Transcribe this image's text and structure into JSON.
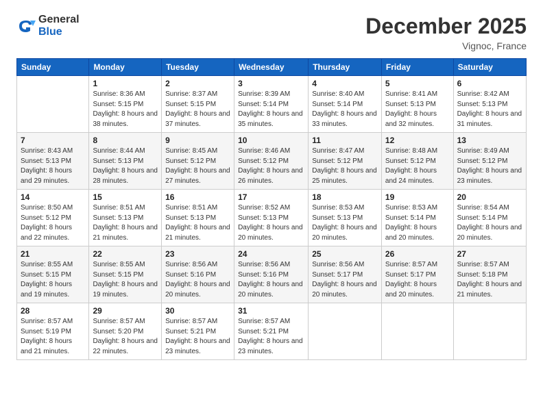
{
  "logo": {
    "general": "General",
    "blue": "Blue"
  },
  "header": {
    "month": "December 2025",
    "location": "Vignoc, France"
  },
  "weekdays": [
    "Sunday",
    "Monday",
    "Tuesday",
    "Wednesday",
    "Thursday",
    "Friday",
    "Saturday"
  ],
  "weeks": [
    [
      {
        "num": "",
        "sunrise": "",
        "sunset": "",
        "daylight": ""
      },
      {
        "num": "1",
        "sunrise": "Sunrise: 8:36 AM",
        "sunset": "Sunset: 5:15 PM",
        "daylight": "Daylight: 8 hours and 38 minutes."
      },
      {
        "num": "2",
        "sunrise": "Sunrise: 8:37 AM",
        "sunset": "Sunset: 5:15 PM",
        "daylight": "Daylight: 8 hours and 37 minutes."
      },
      {
        "num": "3",
        "sunrise": "Sunrise: 8:39 AM",
        "sunset": "Sunset: 5:14 PM",
        "daylight": "Daylight: 8 hours and 35 minutes."
      },
      {
        "num": "4",
        "sunrise": "Sunrise: 8:40 AM",
        "sunset": "Sunset: 5:14 PM",
        "daylight": "Daylight: 8 hours and 33 minutes."
      },
      {
        "num": "5",
        "sunrise": "Sunrise: 8:41 AM",
        "sunset": "Sunset: 5:13 PM",
        "daylight": "Daylight: 8 hours and 32 minutes."
      },
      {
        "num": "6",
        "sunrise": "Sunrise: 8:42 AM",
        "sunset": "Sunset: 5:13 PM",
        "daylight": "Daylight: 8 hours and 31 minutes."
      }
    ],
    [
      {
        "num": "7",
        "sunrise": "Sunrise: 8:43 AM",
        "sunset": "Sunset: 5:13 PM",
        "daylight": "Daylight: 8 hours and 29 minutes."
      },
      {
        "num": "8",
        "sunrise": "Sunrise: 8:44 AM",
        "sunset": "Sunset: 5:13 PM",
        "daylight": "Daylight: 8 hours and 28 minutes."
      },
      {
        "num": "9",
        "sunrise": "Sunrise: 8:45 AM",
        "sunset": "Sunset: 5:12 PM",
        "daylight": "Daylight: 8 hours and 27 minutes."
      },
      {
        "num": "10",
        "sunrise": "Sunrise: 8:46 AM",
        "sunset": "Sunset: 5:12 PM",
        "daylight": "Daylight: 8 hours and 26 minutes."
      },
      {
        "num": "11",
        "sunrise": "Sunrise: 8:47 AM",
        "sunset": "Sunset: 5:12 PM",
        "daylight": "Daylight: 8 hours and 25 minutes."
      },
      {
        "num": "12",
        "sunrise": "Sunrise: 8:48 AM",
        "sunset": "Sunset: 5:12 PM",
        "daylight": "Daylight: 8 hours and 24 minutes."
      },
      {
        "num": "13",
        "sunrise": "Sunrise: 8:49 AM",
        "sunset": "Sunset: 5:12 PM",
        "daylight": "Daylight: 8 hours and 23 minutes."
      }
    ],
    [
      {
        "num": "14",
        "sunrise": "Sunrise: 8:50 AM",
        "sunset": "Sunset: 5:12 PM",
        "daylight": "Daylight: 8 hours and 22 minutes."
      },
      {
        "num": "15",
        "sunrise": "Sunrise: 8:51 AM",
        "sunset": "Sunset: 5:13 PM",
        "daylight": "Daylight: 8 hours and 21 minutes."
      },
      {
        "num": "16",
        "sunrise": "Sunrise: 8:51 AM",
        "sunset": "Sunset: 5:13 PM",
        "daylight": "Daylight: 8 hours and 21 minutes."
      },
      {
        "num": "17",
        "sunrise": "Sunrise: 8:52 AM",
        "sunset": "Sunset: 5:13 PM",
        "daylight": "Daylight: 8 hours and 20 minutes."
      },
      {
        "num": "18",
        "sunrise": "Sunrise: 8:53 AM",
        "sunset": "Sunset: 5:13 PM",
        "daylight": "Daylight: 8 hours and 20 minutes."
      },
      {
        "num": "19",
        "sunrise": "Sunrise: 8:53 AM",
        "sunset": "Sunset: 5:14 PM",
        "daylight": "Daylight: 8 hours and 20 minutes."
      },
      {
        "num": "20",
        "sunrise": "Sunrise: 8:54 AM",
        "sunset": "Sunset: 5:14 PM",
        "daylight": "Daylight: 8 hours and 20 minutes."
      }
    ],
    [
      {
        "num": "21",
        "sunrise": "Sunrise: 8:55 AM",
        "sunset": "Sunset: 5:15 PM",
        "daylight": "Daylight: 8 hours and 19 minutes."
      },
      {
        "num": "22",
        "sunrise": "Sunrise: 8:55 AM",
        "sunset": "Sunset: 5:15 PM",
        "daylight": "Daylight: 8 hours and 19 minutes."
      },
      {
        "num": "23",
        "sunrise": "Sunrise: 8:56 AM",
        "sunset": "Sunset: 5:16 PM",
        "daylight": "Daylight: 8 hours and 20 minutes."
      },
      {
        "num": "24",
        "sunrise": "Sunrise: 8:56 AM",
        "sunset": "Sunset: 5:16 PM",
        "daylight": "Daylight: 8 hours and 20 minutes."
      },
      {
        "num": "25",
        "sunrise": "Sunrise: 8:56 AM",
        "sunset": "Sunset: 5:17 PM",
        "daylight": "Daylight: 8 hours and 20 minutes."
      },
      {
        "num": "26",
        "sunrise": "Sunrise: 8:57 AM",
        "sunset": "Sunset: 5:17 PM",
        "daylight": "Daylight: 8 hours and 20 minutes."
      },
      {
        "num": "27",
        "sunrise": "Sunrise: 8:57 AM",
        "sunset": "Sunset: 5:18 PM",
        "daylight": "Daylight: 8 hours and 21 minutes."
      }
    ],
    [
      {
        "num": "28",
        "sunrise": "Sunrise: 8:57 AM",
        "sunset": "Sunset: 5:19 PM",
        "daylight": "Daylight: 8 hours and 21 minutes."
      },
      {
        "num": "29",
        "sunrise": "Sunrise: 8:57 AM",
        "sunset": "Sunset: 5:20 PM",
        "daylight": "Daylight: 8 hours and 22 minutes."
      },
      {
        "num": "30",
        "sunrise": "Sunrise: 8:57 AM",
        "sunset": "Sunset: 5:21 PM",
        "daylight": "Daylight: 8 hours and 23 minutes."
      },
      {
        "num": "31",
        "sunrise": "Sunrise: 8:57 AM",
        "sunset": "Sunset: 5:21 PM",
        "daylight": "Daylight: 8 hours and 23 minutes."
      },
      {
        "num": "",
        "sunrise": "",
        "sunset": "",
        "daylight": ""
      },
      {
        "num": "",
        "sunrise": "",
        "sunset": "",
        "daylight": ""
      },
      {
        "num": "",
        "sunrise": "",
        "sunset": "",
        "daylight": ""
      }
    ]
  ]
}
